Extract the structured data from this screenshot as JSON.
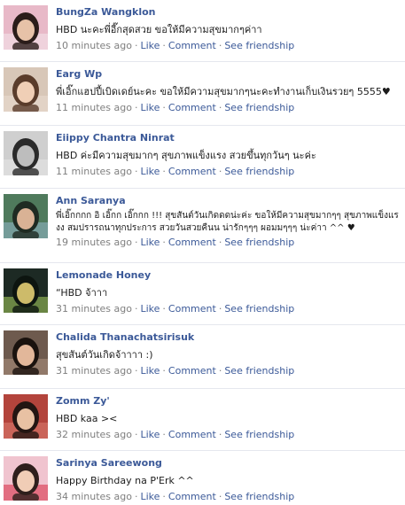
{
  "posts": [
    {
      "author": "BungZa Wangklon",
      "message": "HBD นะคะพี่อี๊กสุดสวย ขอให้มีความสุขมากๆค่าา",
      "time": "10 minutes ago",
      "like_label": "Like",
      "comment_label": "Comment",
      "friendship_label": "See friendship",
      "avatar_colors": {
        "bg": "#e8b9c8",
        "skin": "#e7c2a8",
        "hair": "#2b1d1a",
        "accent": "#f4e3ea"
      }
    },
    {
      "author": "Earg Wp",
      "message": "พี่เอิ๊กแฮปปี้เบิดเดย์นะคะ ขอให้มีความสุขมากๆนะคะทำงานเก็บเงินรวยๆ 5555♥",
      "time": "11 minutes ago",
      "like_label": "Like",
      "comment_label": "Comment",
      "friendship_label": "See friendship",
      "avatar_colors": {
        "bg": "#d8c7b8",
        "skin": "#f0cfb6",
        "hair": "#5a3c2b",
        "accent": "#e9dbcf"
      }
    },
    {
      "author": "Eiippy Chantra Ninrat",
      "message": "HBD ค่ะมีความสุขมากๆ สุขภาพแข็งแรง สวยขึ้นทุกวันๆ นะค่ะ",
      "time": "11 minutes ago",
      "like_label": "Like",
      "comment_label": "Comment",
      "friendship_label": "See friendship",
      "avatar_colors": {
        "bg": "#cfcfcf",
        "skin": "#bdbdbd",
        "hair": "#2a2a2a",
        "accent": "#e5e5e5"
      }
    },
    {
      "author": "Ann Saranya",
      "message": "พี่เอิ๊กกกก อิ เอิ๊กก เอิ๊กกก !!! สุขสันต์วันเกิดดดน่ะค่ะ ขอให้มีความสุขมากๆๆ สุขภาพแข็งแรงง สมปรารถนาทุกประการ สวยวันสวยคืนน น่ารักๆๆๆ ผอมมๆๆๆ น่ะค่าา ^^ ♥",
      "time": "19 minutes ago",
      "like_label": "Like",
      "comment_label": "Comment",
      "friendship_label": "See friendship",
      "avatar_colors": {
        "bg": "#4f7a5c",
        "skin": "#d9b295",
        "hair": "#1f2b22",
        "accent": "#8fb3c2"
      }
    },
    {
      "author": "Lemonade Honey",
      "message": "“HBD จ้าาา",
      "time": "31 minutes ago",
      "like_label": "Like",
      "comment_label": "Comment",
      "friendship_label": "See friendship",
      "avatar_colors": {
        "bg": "#1d2a24",
        "skin": "#cdbb6a",
        "hair": "#0d1510",
        "accent": "#9fc55a"
      }
    },
    {
      "author": "Chalida Thanachatsirisuk",
      "message": "สุขสันต์วันเกิดจ้าาาา :)",
      "time": "31 minutes ago",
      "like_label": "Like",
      "comment_label": "Comment",
      "friendship_label": "See friendship",
      "avatar_colors": {
        "bg": "#6e5a4e",
        "skin": "#e2b79a",
        "hair": "#1a120e",
        "accent": "#a98d7c"
      }
    },
    {
      "author": "Zomm Zy'",
      "message": "HBD kaa ><",
      "time": "32 minutes ago",
      "like_label": "Like",
      "comment_label": "Comment",
      "friendship_label": "See friendship",
      "avatar_colors": {
        "bg": "#b3443c",
        "skin": "#e8c1a3",
        "hair": "#231512",
        "accent": "#d97a6c"
      }
    },
    {
      "author": "Sarinya Sareewong",
      "message": "Happy Birthday na P'Erk ^^",
      "time": "34 minutes ago",
      "like_label": "Like",
      "comment_label": "Comment",
      "friendship_label": "See friendship",
      "avatar_colors": {
        "bg": "#f0c4cf",
        "skin": "#f0cdb6",
        "hair": "#2e1f1c",
        "accent": "#d8354d"
      }
    }
  ]
}
